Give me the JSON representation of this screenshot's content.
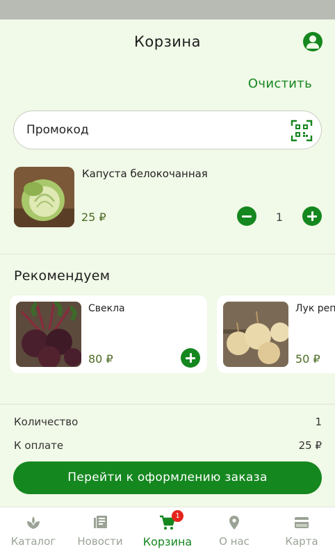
{
  "header": {
    "title": "Корзина"
  },
  "actions": {
    "clear_label": "Очистить"
  },
  "promo": {
    "placeholder": "Промокод"
  },
  "cart": {
    "items": [
      {
        "name": "Капуста белокочанная",
        "price": "25 ₽",
        "quantity": "1"
      }
    ]
  },
  "recommended": {
    "title": "Рекомендуем",
    "items": [
      {
        "name": "Свекла",
        "price": "80 ₽"
      },
      {
        "name": "Лук репчатый",
        "price": "50 ₽"
      }
    ]
  },
  "summary": {
    "quantity_label": "Количество",
    "quantity_value": "1",
    "total_label": "К оплате",
    "total_value": "25 ₽"
  },
  "checkout": {
    "label": "Перейти к оформлению заказа"
  },
  "tabbar": {
    "tabs": [
      {
        "label": "Каталог",
        "icon": "leaf-icon"
      },
      {
        "label": "Новости",
        "icon": "news-icon"
      },
      {
        "label": "Корзина",
        "icon": "cart-icon",
        "badge": "1",
        "active": true
      },
      {
        "label": "О нас",
        "icon": "location-icon"
      },
      {
        "label": "Карта",
        "icon": "card-icon"
      }
    ]
  },
  "colors": {
    "accent": "#14871f",
    "background": "#f1f9e8",
    "badge": "#e5231b",
    "inactive": "#9aa395"
  }
}
